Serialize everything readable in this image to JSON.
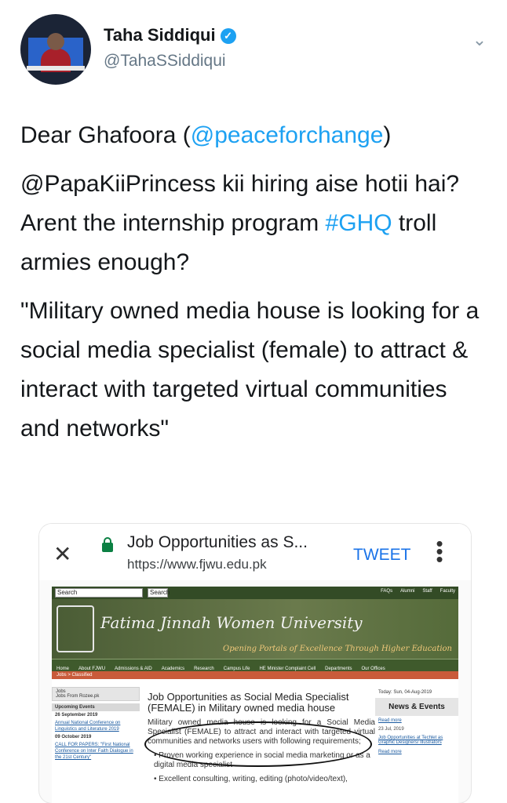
{
  "author": {
    "name": "Taha Siddiqui",
    "handle": "@TahaSSiddiqui",
    "verified_icon": "verified-badge-icon",
    "menu_icon": "chevron-down-icon"
  },
  "tweet": {
    "line1_prefix": "Dear Ghafoora (",
    "line1_mention": "@peaceforchange",
    "line1_suffix": ")",
    "para2_start": "@PapaKiiPrincess kii hiring aise hotii hai? Arent the internship program ",
    "para2_hashtag": "#GHQ",
    "para2_end": " troll armies enough?",
    "para3": "\"Military owned media house is looking for a social media specialist (female) to attract & interact with targeted virtual communities and networks\"",
    "link_color": "#1da1f2"
  },
  "screenshot": {
    "browser": {
      "close_icon": "close-icon",
      "title": "Job Opportunities as S...",
      "url": "https://www.fjwu.edu.pk",
      "tweet_button": "TWEET",
      "menu_icon": "more-vert-icon"
    },
    "site": {
      "search_label_1": "Search",
      "search_label_2": "Search",
      "top_links": [
        "FAQs",
        "Alumni",
        "Staff",
        "Faculty"
      ],
      "university_name": "Fatima Jinnah Women University",
      "tagline": "Opening Portals of Excellence Through Higher Education",
      "nav_items": [
        "Home",
        "About FJWU",
        "Admissions & AID",
        "Academics",
        "Research",
        "Campus Life",
        "HE Minister Complaint Cell",
        "Departments",
        "Our Offices"
      ],
      "breadcrumb": "Jobs > Classified",
      "left": {
        "jobs_header": "Jobs",
        "jobs_item": "Jobs From Rozee.pk",
        "events_header": "Upcoming Events",
        "event1_date": "26 September 2019",
        "event1_link": "Annual National Conference on Linguistics and Literature 2019",
        "event2_date": "09 October 2019",
        "event2_link": "CALL FOR PAPERS: \"First National Conference on Inter Faith Dialogue in the 21st Century\""
      },
      "article": {
        "title": "Job Opportunities as Social Media Specialist (FEMALE) in Military owned media house",
        "body": "Military owned media house is looking for a Social Media Specialist (FEMALE) to attract and interact with targeted virtual communities and networks users with following requirements;",
        "bullet1": "• Proven working experience in social media marketing or as a digital media specialist",
        "bullet2": "• Excellent consulting, writing, editing (photo/video/text),"
      },
      "right": {
        "today": "Today: Sun, 04-Aug-2019",
        "news_header": "News & Events",
        "read_more_1": "Read more",
        "date_1": "23 Jul, 2019",
        "news_link": "Job Opportunities at Techlet as Graphic Designers/ Illustrators",
        "read_more_2": "Read more"
      }
    }
  }
}
